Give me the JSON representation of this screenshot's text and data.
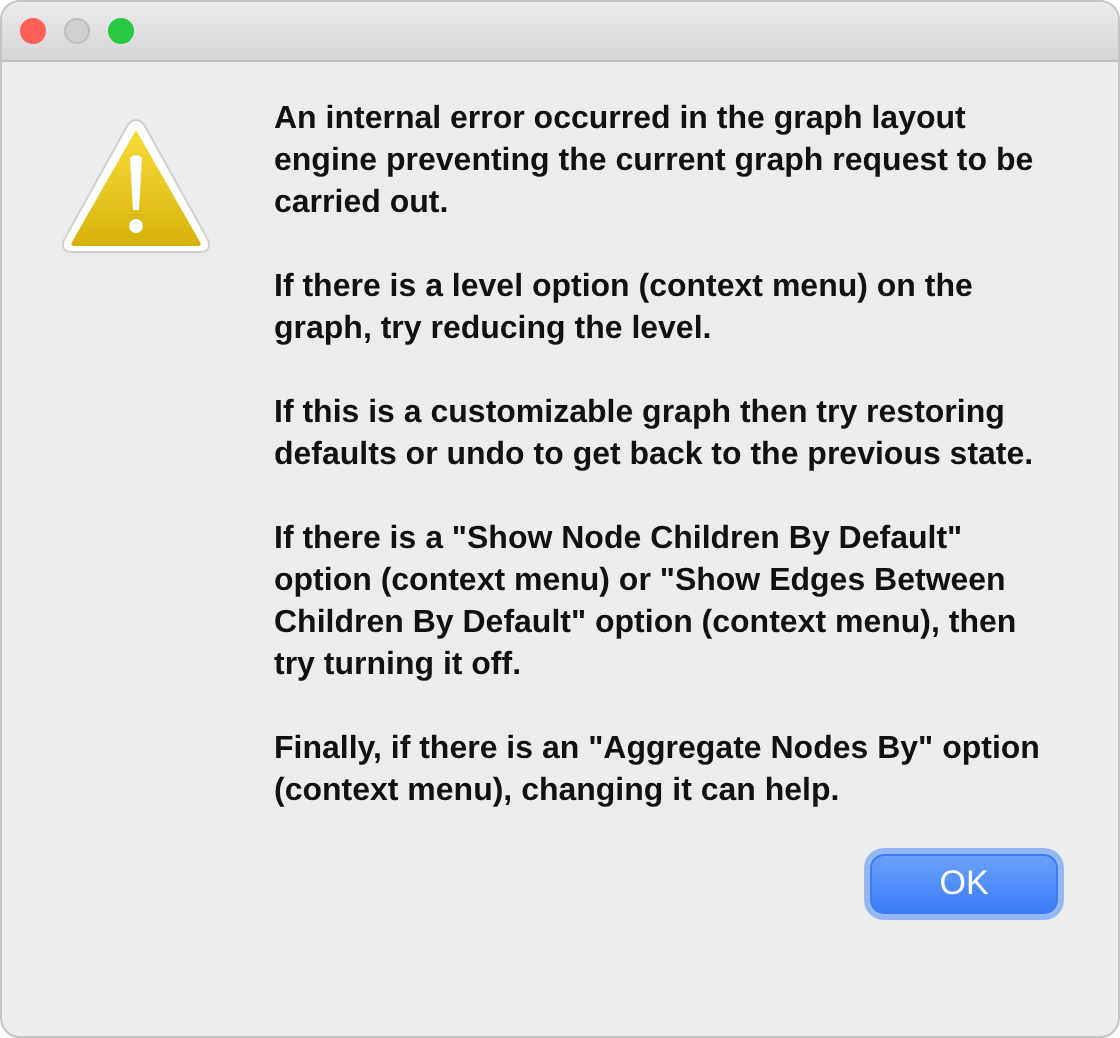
{
  "window": {
    "controls": [
      {
        "kind": "close",
        "disabled": false
      },
      {
        "kind": "minimize",
        "disabled": true
      },
      {
        "kind": "zoom",
        "disabled": false
      }
    ]
  },
  "message": {
    "paragraphs": [
      "An internal error occurred in the graph layout engine preventing the current graph request to be carried out.",
      "If there is a level option (context menu) on the graph, try reducing the level.",
      "If this is a customizable graph then try restoring defaults or undo to get back to the previous state.",
      "If there is a \"Show Node Children By Default\" option (context menu) or \"Show Edges Between Children By Default\" option (context menu), then try turning it off.",
      "Finally, if there is an \"Aggregate Nodes By\" option (context menu), changing it can help."
    ]
  },
  "buttons": [
    {
      "label": "OK",
      "default": true
    }
  ]
}
